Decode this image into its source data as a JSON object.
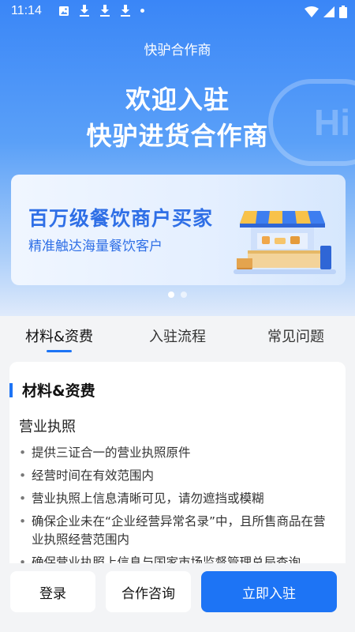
{
  "status_bar": {
    "time": "11:14"
  },
  "header": {
    "title": "快驴合作商"
  },
  "hero": {
    "line1": "欢迎入驻",
    "line2": "快驴进货合作商",
    "deco_text": "Hi"
  },
  "banner": {
    "title": "百万级餐饮商户买家",
    "subtitle": "精准触达海量餐饮客户",
    "total_slides": 2,
    "active_slide": 1
  },
  "tabs": [
    {
      "label": "材料&资费",
      "active": true
    },
    {
      "label": "入驻流程",
      "active": false
    },
    {
      "label": "常见问题",
      "active": false
    }
  ],
  "card": {
    "heading": "材料&资费",
    "section_title": "营业执照",
    "items": [
      "提供三证合一的营业执照原件",
      "经营时间在有效范围内",
      "营业执照上信息清晰可见，请勿遮挡或模糊",
      "确保企业未在“企业经营异常名录”中，且所售商品在营业执照经营范围内",
      "确保营业执照上信息与国家市场监督管理总局查询"
    ]
  },
  "footer": {
    "login": "登录",
    "consult": "合作咨询",
    "join": "立即入驻"
  },
  "colors": {
    "accent": "#1d74f5",
    "banner_text": "#2f6fe6"
  }
}
